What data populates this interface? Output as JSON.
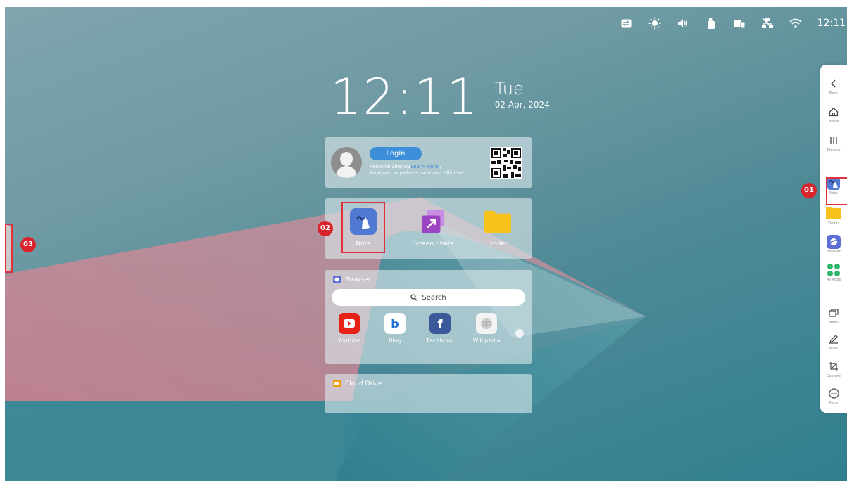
{
  "status_bar": {
    "icons": [
      "input-icon",
      "brightness-icon",
      "volume-icon",
      "usb-icon",
      "display-icon",
      "network-off-icon",
      "wifi-icon"
    ],
    "time": "12:11"
  },
  "clock": {
    "time": "12:11",
    "day": "Tue",
    "date": "02 Apr, 2024"
  },
  "login": {
    "button_label": "Login",
    "line1_prefix": "Personalizing OS",
    "line1_link": "Learn More",
    "line1_suffix": " /",
    "line2": "Anytime, anywhere, safe and efficient."
  },
  "apps": [
    {
      "label": "Note",
      "icon": "note-icon"
    },
    {
      "label": "Screen Share",
      "icon": "screen-share-icon"
    },
    {
      "label": "Finder",
      "icon": "finder-icon"
    }
  ],
  "browser": {
    "title": "Browser",
    "search_placeholder": "Search",
    "sites": [
      {
        "label": "Youtube",
        "icon": "youtube-icon",
        "color": "#e62117"
      },
      {
        "label": "Bing",
        "icon": "bing-icon",
        "color": "#1e74d6"
      },
      {
        "label": "Facebook",
        "icon": "facebook-icon",
        "color": "#3b5998"
      },
      {
        "label": "Wikipedia",
        "icon": "wikipedia-icon",
        "color": "#dddddd"
      }
    ]
  },
  "cloud_drive": {
    "title": "Cloud Drive"
  },
  "toolbar": {
    "items": [
      {
        "label": "Back",
        "icon": "back-icon"
      },
      {
        "label": "Home",
        "icon": "home-icon"
      },
      {
        "label": "Process",
        "icon": "process-icon"
      },
      {
        "label": "Note",
        "icon": "note-icon"
      },
      {
        "label": "Finder",
        "icon": "finder-icon"
      },
      {
        "label": "Browser",
        "icon": "browser-icon"
      },
      {
        "label": "All Apps",
        "icon": "all-apps-icon"
      },
      {
        "label": "Menu",
        "icon": "menu-icon"
      },
      {
        "label": "Mark",
        "icon": "mark-icon"
      },
      {
        "label": "Capture",
        "icon": "capture-icon"
      },
      {
        "label": "More",
        "icon": "more-icon"
      }
    ]
  },
  "callouts": {
    "toolbar_note": "01",
    "app_note": "02",
    "side_handle": "03"
  },
  "colors": {
    "accent_blue": "#3d8ed8",
    "callout_red": "#d9232d",
    "highlight_red": "#e0303a",
    "finder_yellow": "#f8c21c"
  }
}
